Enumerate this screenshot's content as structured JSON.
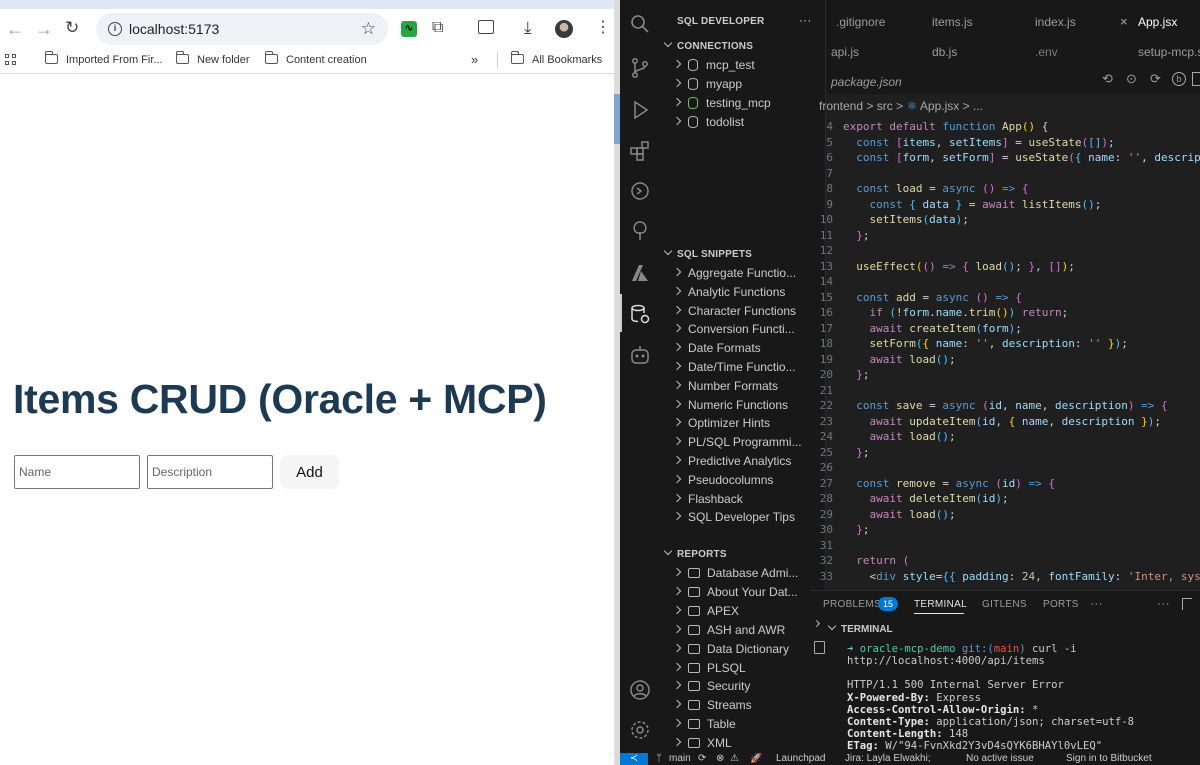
{
  "browser": {
    "url": "localhost:5173",
    "bookmarks": [
      "Imported From Fir...",
      "New folder",
      "Content creation"
    ],
    "more_bookmarks_icon": "»",
    "all_bookmarks": "All Bookmarks"
  },
  "page": {
    "title": "Items CRUD (Oracle + MCP)",
    "name_placeholder": "Name",
    "description_placeholder": "Description",
    "add_label": "Add"
  },
  "vscode": {
    "sidebar_title": "SQL DEVELOPER",
    "sidebar_more": "···",
    "connections_header": "CONNECTIONS",
    "connections": [
      "mcp_test",
      "myapp",
      "testing_mcp",
      "todolist"
    ],
    "snippets_header": "SQL SNIPPETS",
    "snippets": [
      "Aggregate Functio...",
      "Analytic Functions",
      "Character Functions",
      "Conversion Functi...",
      "Date Formats",
      "Date/Time Functio...",
      "Number Formats",
      "Numeric Functions",
      "Optimizer Hints",
      "PL/SQL Programmi...",
      "Predictive Analytics",
      "Pseudocolumns",
      "Flashback",
      "SQL Developer Tips"
    ],
    "reports_header": "REPORTS",
    "reports": [
      "Database Admi...",
      "About Your Dat...",
      "APEX",
      "ASH and AWR",
      "Data Dictionary",
      "PLSQL",
      "Security",
      "Streams",
      "Table",
      "XML"
    ],
    "tabs_row1": [
      ".gitignore",
      "items.js",
      "index.js",
      "App.jsx"
    ],
    "tabs_row2": [
      "api.js",
      "db.js",
      ".env",
      "setup-mcp.s"
    ],
    "tab_row3": "package.json",
    "close_icon": "×",
    "breadcrumb": [
      "frontend",
      "src",
      "App.jsx",
      "..."
    ],
    "breadcrumb_sep": ">",
    "panel_tabs": [
      "PROBLEMS",
      "TERMINAL",
      "GITLENS",
      "PORTS"
    ],
    "problems_count": "15",
    "panel_more": "···",
    "terminal_header": "TERMINAL",
    "prompt": {
      "arrow": "➜",
      "repo": "oracle-mcp-demo",
      "git_prefix": "git:(",
      "branch": "main",
      "git_suffix": ")",
      "command": "curl -i http://localhost:4000/api/items"
    },
    "terminal_lines": [
      {
        "key": "",
        "value": "HTTP/1.1 500 Internal Server Error"
      },
      {
        "key": "X-Powered-By:",
        "value": " Express"
      },
      {
        "key": "Access-Control-Allow-Origin:",
        "value": " *"
      },
      {
        "key": "Content-Type:",
        "value": " application/json; charset=utf-8"
      },
      {
        "key": "Content-Length:",
        "value": " 148"
      },
      {
        "key": "ETag:",
        "value": " W/\"94-FvnXkd2Y3vD4sQYK6BHAYl0vLEQ\""
      }
    ],
    "status": {
      "branch": "main",
      "launchpad": "Launchpad",
      "jira": "Jira: Layla Elwakhi;",
      "issue": "No active issue",
      "bitbucket": "Sign in to Bitbucket"
    }
  },
  "code_lines": [
    {
      "n": "4",
      "t": [
        [
          "kp",
          "export "
        ],
        [
          "kp",
          "default "
        ],
        [
          "kw",
          "function "
        ],
        [
          "fn",
          "App"
        ],
        [
          "br",
          "() "
        ],
        [
          "pn",
          "{"
        ]
      ]
    },
    {
      "n": "5",
      "t": [
        [
          "kw",
          "  const "
        ],
        [
          "bp",
          "["
        ],
        [
          "vr",
          "items"
        ],
        [
          "pn",
          ", "
        ],
        [
          "vr",
          "setItems"
        ],
        [
          "bp",
          "] "
        ],
        [
          "pn",
          "= "
        ],
        [
          "fn",
          "useState"
        ],
        [
          "bp",
          "("
        ],
        [
          "cst",
          "[]"
        ],
        [
          "bp",
          ")"
        ],
        [
          "pn",
          ";"
        ]
      ]
    },
    {
      "n": "6",
      "t": [
        [
          "kw",
          "  const "
        ],
        [
          "bp",
          "["
        ],
        [
          "vr",
          "form"
        ],
        [
          "pn",
          ", "
        ],
        [
          "vr",
          "setForm"
        ],
        [
          "bp",
          "] "
        ],
        [
          "pn",
          "= "
        ],
        [
          "fn",
          "useState"
        ],
        [
          "bp",
          "("
        ],
        [
          "cst",
          "{ "
        ],
        [
          "vr",
          "name"
        ],
        [
          "pn",
          ": "
        ],
        [
          "st",
          "''"
        ],
        [
          "pn",
          ", "
        ],
        [
          "vr",
          "description"
        ],
        [
          "pn",
          ":"
        ]
      ]
    },
    {
      "n": "7",
      "t": []
    },
    {
      "n": "8",
      "t": [
        [
          "kw",
          "  const "
        ],
        [
          "fn",
          "load "
        ],
        [
          "pn",
          "= "
        ],
        [
          "kw",
          "async "
        ],
        [
          "bp",
          "() "
        ],
        [
          "kw",
          "=> "
        ],
        [
          "bp",
          "{"
        ]
      ]
    },
    {
      "n": "9",
      "t": [
        [
          "kw",
          "    const "
        ],
        [
          "cst",
          "{ "
        ],
        [
          "vr",
          "data "
        ],
        [
          "cst",
          "} "
        ],
        [
          "pn",
          "= "
        ],
        [
          "kp",
          "await "
        ],
        [
          "fn",
          "listItems"
        ],
        [
          "cst",
          "()"
        ],
        [
          "pn",
          ";"
        ]
      ]
    },
    {
      "n": "10",
      "t": [
        [
          "fn",
          "    setItems"
        ],
        [
          "cst",
          "("
        ],
        [
          "vr",
          "data"
        ],
        [
          "cst",
          ")"
        ],
        [
          "pn",
          ";"
        ]
      ]
    },
    {
      "n": "11",
      "t": [
        [
          "bp",
          "  }"
        ],
        [
          "pn",
          ";"
        ]
      ]
    },
    {
      "n": "12",
      "t": []
    },
    {
      "n": "13",
      "t": [
        [
          "fn",
          "  useEffect"
        ],
        [
          "br",
          "("
        ],
        [
          "bp",
          "() "
        ],
        [
          "kw",
          "=> "
        ],
        [
          "bp",
          "{ "
        ],
        [
          "fn",
          "load"
        ],
        [
          "cst",
          "()"
        ],
        [
          "pn",
          "; "
        ],
        [
          "bp",
          "}"
        ],
        [
          "pn",
          ", "
        ],
        [
          "bp",
          "[]"
        ],
        [
          "br",
          ")"
        ],
        [
          "pn",
          ";"
        ]
      ]
    },
    {
      "n": "14",
      "t": []
    },
    {
      "n": "15",
      "t": [
        [
          "kw",
          "  const "
        ],
        [
          "fn",
          "add "
        ],
        [
          "pn",
          "= "
        ],
        [
          "kw",
          "async "
        ],
        [
          "bp",
          "() "
        ],
        [
          "kw",
          "=> "
        ],
        [
          "bp",
          "{"
        ]
      ]
    },
    {
      "n": "16",
      "t": [
        [
          "kp",
          "    if "
        ],
        [
          "cst",
          "("
        ],
        [
          "pn",
          "!"
        ],
        [
          "vr",
          "form"
        ],
        [
          "pn",
          "."
        ],
        [
          "vr",
          "name"
        ],
        [
          "pn",
          "."
        ],
        [
          "fn",
          "trim"
        ],
        [
          "br",
          "()"
        ],
        [
          "cst",
          ") "
        ],
        [
          "kp",
          "return"
        ],
        [
          "pn",
          ";"
        ]
      ]
    },
    {
      "n": "17",
      "t": [
        [
          "kp",
          "    await "
        ],
        [
          "fn",
          "createItem"
        ],
        [
          "cst",
          "("
        ],
        [
          "vr",
          "form"
        ],
        [
          "cst",
          ")"
        ],
        [
          "pn",
          ";"
        ]
      ]
    },
    {
      "n": "18",
      "t": [
        [
          "fn",
          "    setForm"
        ],
        [
          "cst",
          "("
        ],
        [
          "br",
          "{ "
        ],
        [
          "vr",
          "name"
        ],
        [
          "pn",
          ": "
        ],
        [
          "st",
          "''"
        ],
        [
          "pn",
          ", "
        ],
        [
          "vr",
          "description"
        ],
        [
          "pn",
          ": "
        ],
        [
          "st",
          "'' "
        ],
        [
          "br",
          "}"
        ],
        [
          "cst",
          ")"
        ],
        [
          "pn",
          ";"
        ]
      ]
    },
    {
      "n": "19",
      "t": [
        [
          "kp",
          "    await "
        ],
        [
          "fn",
          "load"
        ],
        [
          "cst",
          "()"
        ],
        [
          "pn",
          ";"
        ]
      ]
    },
    {
      "n": "20",
      "t": [
        [
          "bp",
          "  }"
        ],
        [
          "pn",
          ";"
        ]
      ]
    },
    {
      "n": "21",
      "t": []
    },
    {
      "n": "22",
      "t": [
        [
          "kw",
          "  const "
        ],
        [
          "fn",
          "save "
        ],
        [
          "pn",
          "= "
        ],
        [
          "kw",
          "async "
        ],
        [
          "bp",
          "("
        ],
        [
          "vr",
          "id"
        ],
        [
          "pn",
          ", "
        ],
        [
          "vr",
          "name"
        ],
        [
          "pn",
          ", "
        ],
        [
          "vr",
          "description"
        ],
        [
          "bp",
          ") "
        ],
        [
          "kw",
          "=> "
        ],
        [
          "bp",
          "{"
        ]
      ]
    },
    {
      "n": "23",
      "t": [
        [
          "kp",
          "    await "
        ],
        [
          "fn",
          "updateItem"
        ],
        [
          "cst",
          "("
        ],
        [
          "vr",
          "id"
        ],
        [
          "pn",
          ", "
        ],
        [
          "br",
          "{ "
        ],
        [
          "vr",
          "name"
        ],
        [
          "pn",
          ", "
        ],
        [
          "vr",
          "description "
        ],
        [
          "br",
          "}"
        ],
        [
          "cst",
          ")"
        ],
        [
          "pn",
          ";"
        ]
      ]
    },
    {
      "n": "24",
      "t": [
        [
          "kp",
          "    await "
        ],
        [
          "fn",
          "load"
        ],
        [
          "cst",
          "()"
        ],
        [
          "pn",
          ";"
        ]
      ]
    },
    {
      "n": "25",
      "t": [
        [
          "bp",
          "  }"
        ],
        [
          "pn",
          ";"
        ]
      ]
    },
    {
      "n": "26",
      "t": []
    },
    {
      "n": "27",
      "t": [
        [
          "kw",
          "  const "
        ],
        [
          "fn",
          "remove "
        ],
        [
          "pn",
          "= "
        ],
        [
          "kw",
          "async "
        ],
        [
          "bp",
          "("
        ],
        [
          "vr",
          "id"
        ],
        [
          "bp",
          ") "
        ],
        [
          "kw",
          "=> "
        ],
        [
          "bp",
          "{"
        ]
      ]
    },
    {
      "n": "28",
      "t": [
        [
          "kp",
          "    await "
        ],
        [
          "fn",
          "deleteItem"
        ],
        [
          "cst",
          "("
        ],
        [
          "vr",
          "id"
        ],
        [
          "cst",
          ")"
        ],
        [
          "pn",
          ";"
        ]
      ]
    },
    {
      "n": "29",
      "t": [
        [
          "kp",
          "    await "
        ],
        [
          "fn",
          "load"
        ],
        [
          "cst",
          "()"
        ],
        [
          "pn",
          ";"
        ]
      ]
    },
    {
      "n": "30",
      "t": [
        [
          "bp",
          "  }"
        ],
        [
          "pn",
          ";"
        ]
      ]
    },
    {
      "n": "31",
      "t": []
    },
    {
      "n": "32",
      "t": [
        [
          "kp",
          "  return "
        ],
        [
          "bp",
          "("
        ]
      ]
    },
    {
      "n": "33",
      "t": [
        [
          "pn",
          "    <"
        ],
        [
          "kw",
          "div "
        ],
        [
          "vr",
          "style"
        ],
        [
          "pn",
          "="
        ],
        [
          "cst",
          "{{ "
        ],
        [
          "vr",
          "padding"
        ],
        [
          "pn",
          ": "
        ],
        [
          "nm",
          "24"
        ],
        [
          "pn",
          ", "
        ],
        [
          "vr",
          "fontFamily"
        ],
        [
          "pn",
          ": "
        ],
        [
          "st",
          "'Inter, system-ui"
        ]
      ]
    }
  ],
  "colors": {
    "heading": "#1e3a52",
    "vscode_bg": "#1f1f1f",
    "badge": "#0078d4",
    "prompt": "#4ec9b0"
  }
}
